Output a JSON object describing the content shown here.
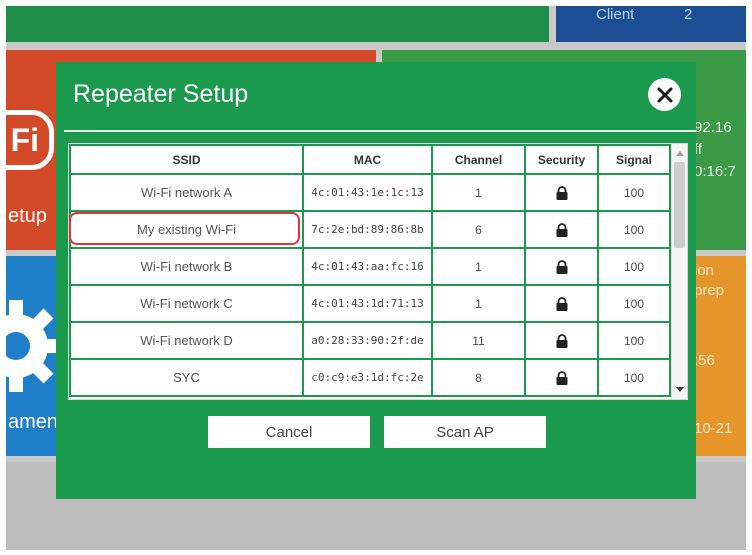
{
  "background": {
    "top_right_tile": {
      "label": "Client",
      "value": "2"
    },
    "right_tile_1_lines": [
      "92.16",
      "ff",
      "0:16:7"
    ],
    "right_tile_2_lines": [
      "ion",
      "prep",
      "",
      ":56",
      "",
      "10-21"
    ],
    "left_tile_1": {
      "badge": "Fi",
      "label": "etup"
    },
    "left_tile_2": {
      "label": "ament"
    }
  },
  "dialog": {
    "title": "Repeater Setup",
    "close_icon": "close-icon",
    "columns": [
      "SSID",
      "MAC",
      "Channel",
      "Security",
      "Signal"
    ],
    "rows": [
      {
        "ssid": "Wi-Fi network A",
        "mac": "4c:01:43:1e:1c:13",
        "channel": "1",
        "security": "lock-icon",
        "signal": "100"
      },
      {
        "ssid": "My existing Wi-Fi",
        "mac": "7c:2e:bd:89:86:8b",
        "channel": "6",
        "security": "lock-icon",
        "signal": "100"
      },
      {
        "ssid": "Wi-Fi network B",
        "mac": "4c:01:43:aa:fc:16",
        "channel": "1",
        "security": "lock-icon",
        "signal": "100"
      },
      {
        "ssid": "Wi-Fi network C",
        "mac": "4c:01:43:1d:71:13",
        "channel": "1",
        "security": "lock-icon",
        "signal": "100"
      },
      {
        "ssid": "Wi-Fi network D",
        "mac": "a0:28:33:90:2f:de",
        "channel": "11",
        "security": "lock-icon",
        "signal": "100"
      },
      {
        "ssid": "SYC",
        "mac": "c0:c9:e3:1d:fc:2e",
        "channel": "8",
        "security": "lock-icon",
        "signal": "100"
      }
    ],
    "buttons": {
      "cancel": "Cancel",
      "scan": "Scan AP"
    }
  },
  "colors": {
    "dialog_green": "#1b9a4d",
    "highlight_red": "#e0333a"
  }
}
